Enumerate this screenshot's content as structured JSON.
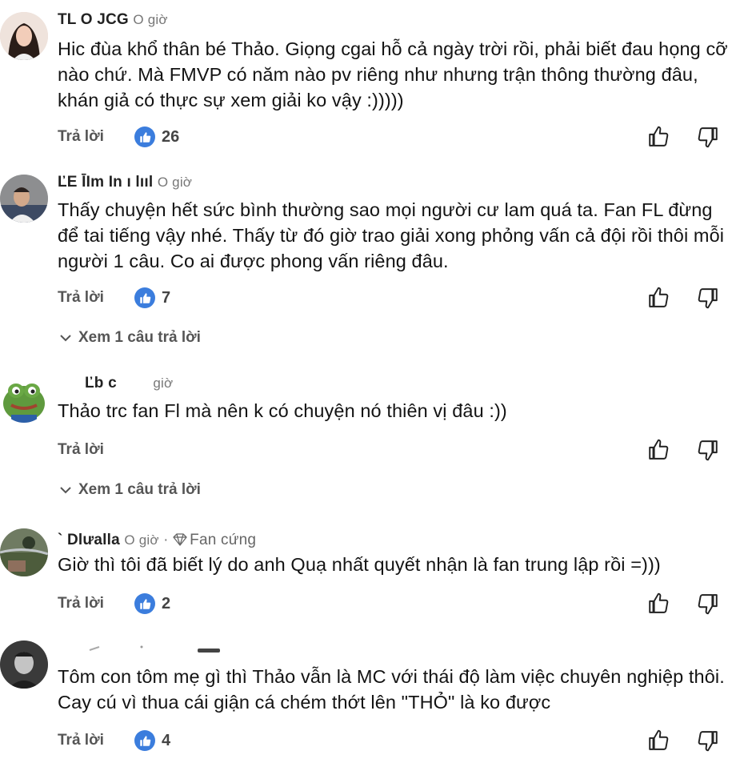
{
  "comments": [
    {
      "author": "TL        O JCG",
      "time": "O giờ",
      "badge": "",
      "text": "Hic đùa khổ thân bé Thảo. Giọng cgai hỗ cả ngày trời rồi, phải biết đau họng cỡ nào chứ. Mà FMVP có năm nào pv riêng như nhưng trận thông thường đâu, khán giả có thực sự xem giải ko vậy :)))))",
      "reply_label": "Trả lời",
      "likes": "26",
      "view_replies": ""
    },
    {
      "author": "ĽE ĪIm In ı lııl",
      "time": "O giờ",
      "badge": "",
      "text": "Thấy chuyện hết sức bình thường sao mọi người cư lam quá ta. Fan FL đừng để tai tiếng vậy nhé. Thấy từ đó giờ trao giải xong phỏng vấn cả đội rồi thôi mỗi người 1 câu. Co ai được phong vấn riêng đâu.",
      "reply_label": "Trả lời",
      "likes": "7",
      "view_replies": "Xem 1 câu trả lời"
    },
    {
      "author": "Ľb c",
      "time": "giờ",
      "badge": "",
      "text": "Thảo trc fan Fl mà nên k có chuyện nó thiên vị đâu :))",
      "reply_label": "Trả lời",
      "likes": "",
      "view_replies": "Xem 1 câu trả lời"
    },
    {
      "author": "` Dlưalla",
      "time": "O giờ",
      "badge": "Fan cứng",
      "text": "Giờ thì tôi đã biết lý do anh Quạ nhất quyết nhận là fan trung lập rồi =)))",
      "reply_label": "Trả lời",
      "likes": "2",
      "view_replies": ""
    },
    {
      "author": "",
      "time": "",
      "badge": "",
      "text": "Tôm con tôm mẹ gì thì Thảo vẫn là MC với thái độ làm việc chuyên nghiệp thôi. Cay cú vì thua cái giận cá chém thớt lên \"THỎ\" là ko được",
      "reply_label": "Trả lời",
      "likes": "4",
      "view_replies": ""
    }
  ],
  "colors": {
    "like_badge": "#3b7ddd",
    "muted_text": "#555555",
    "body_text": "#131313"
  },
  "icons": [
    "thumbs-up-filled-icon",
    "thumbs-up-outline-icon",
    "thumbs-down-outline-icon",
    "chevron-down-icon",
    "diamond-icon"
  ]
}
